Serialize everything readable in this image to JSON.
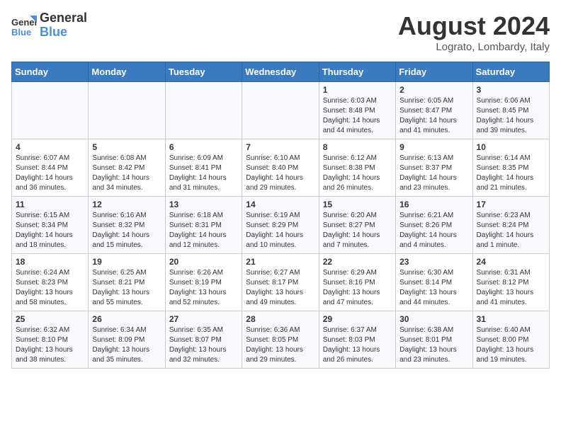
{
  "header": {
    "logo_line1": "General",
    "logo_line2": "Blue",
    "month_title": "August 2024",
    "subtitle": "Lograto, Lombardy, Italy"
  },
  "days_of_week": [
    "Sunday",
    "Monday",
    "Tuesday",
    "Wednesday",
    "Thursday",
    "Friday",
    "Saturday"
  ],
  "weeks": [
    [
      {
        "day": "",
        "info": ""
      },
      {
        "day": "",
        "info": ""
      },
      {
        "day": "",
        "info": ""
      },
      {
        "day": "",
        "info": ""
      },
      {
        "day": "1",
        "info": "Sunrise: 6:03 AM\nSunset: 8:48 PM\nDaylight: 14 hours and 44 minutes."
      },
      {
        "day": "2",
        "info": "Sunrise: 6:05 AM\nSunset: 8:47 PM\nDaylight: 14 hours and 41 minutes."
      },
      {
        "day": "3",
        "info": "Sunrise: 6:06 AM\nSunset: 8:45 PM\nDaylight: 14 hours and 39 minutes."
      }
    ],
    [
      {
        "day": "4",
        "info": "Sunrise: 6:07 AM\nSunset: 8:44 PM\nDaylight: 14 hours and 36 minutes."
      },
      {
        "day": "5",
        "info": "Sunrise: 6:08 AM\nSunset: 8:42 PM\nDaylight: 14 hours and 34 minutes."
      },
      {
        "day": "6",
        "info": "Sunrise: 6:09 AM\nSunset: 8:41 PM\nDaylight: 14 hours and 31 minutes."
      },
      {
        "day": "7",
        "info": "Sunrise: 6:10 AM\nSunset: 8:40 PM\nDaylight: 14 hours and 29 minutes."
      },
      {
        "day": "8",
        "info": "Sunrise: 6:12 AM\nSunset: 8:38 PM\nDaylight: 14 hours and 26 minutes."
      },
      {
        "day": "9",
        "info": "Sunrise: 6:13 AM\nSunset: 8:37 PM\nDaylight: 14 hours and 23 minutes."
      },
      {
        "day": "10",
        "info": "Sunrise: 6:14 AM\nSunset: 8:35 PM\nDaylight: 14 hours and 21 minutes."
      }
    ],
    [
      {
        "day": "11",
        "info": "Sunrise: 6:15 AM\nSunset: 8:34 PM\nDaylight: 14 hours and 18 minutes."
      },
      {
        "day": "12",
        "info": "Sunrise: 6:16 AM\nSunset: 8:32 PM\nDaylight: 14 hours and 15 minutes."
      },
      {
        "day": "13",
        "info": "Sunrise: 6:18 AM\nSunset: 8:31 PM\nDaylight: 14 hours and 12 minutes."
      },
      {
        "day": "14",
        "info": "Sunrise: 6:19 AM\nSunset: 8:29 PM\nDaylight: 14 hours and 10 minutes."
      },
      {
        "day": "15",
        "info": "Sunrise: 6:20 AM\nSunset: 8:27 PM\nDaylight: 14 hours and 7 minutes."
      },
      {
        "day": "16",
        "info": "Sunrise: 6:21 AM\nSunset: 8:26 PM\nDaylight: 14 hours and 4 minutes."
      },
      {
        "day": "17",
        "info": "Sunrise: 6:23 AM\nSunset: 8:24 PM\nDaylight: 14 hours and 1 minute."
      }
    ],
    [
      {
        "day": "18",
        "info": "Sunrise: 6:24 AM\nSunset: 8:23 PM\nDaylight: 13 hours and 58 minutes."
      },
      {
        "day": "19",
        "info": "Sunrise: 6:25 AM\nSunset: 8:21 PM\nDaylight: 13 hours and 55 minutes."
      },
      {
        "day": "20",
        "info": "Sunrise: 6:26 AM\nSunset: 8:19 PM\nDaylight: 13 hours and 52 minutes."
      },
      {
        "day": "21",
        "info": "Sunrise: 6:27 AM\nSunset: 8:17 PM\nDaylight: 13 hours and 49 minutes."
      },
      {
        "day": "22",
        "info": "Sunrise: 6:29 AM\nSunset: 8:16 PM\nDaylight: 13 hours and 47 minutes."
      },
      {
        "day": "23",
        "info": "Sunrise: 6:30 AM\nSunset: 8:14 PM\nDaylight: 13 hours and 44 minutes."
      },
      {
        "day": "24",
        "info": "Sunrise: 6:31 AM\nSunset: 8:12 PM\nDaylight: 13 hours and 41 minutes."
      }
    ],
    [
      {
        "day": "25",
        "info": "Sunrise: 6:32 AM\nSunset: 8:10 PM\nDaylight: 13 hours and 38 minutes."
      },
      {
        "day": "26",
        "info": "Sunrise: 6:34 AM\nSunset: 8:09 PM\nDaylight: 13 hours and 35 minutes."
      },
      {
        "day": "27",
        "info": "Sunrise: 6:35 AM\nSunset: 8:07 PM\nDaylight: 13 hours and 32 minutes."
      },
      {
        "day": "28",
        "info": "Sunrise: 6:36 AM\nSunset: 8:05 PM\nDaylight: 13 hours and 29 minutes."
      },
      {
        "day": "29",
        "info": "Sunrise: 6:37 AM\nSunset: 8:03 PM\nDaylight: 13 hours and 26 minutes."
      },
      {
        "day": "30",
        "info": "Sunrise: 6:38 AM\nSunset: 8:01 PM\nDaylight: 13 hours and 23 minutes."
      },
      {
        "day": "31",
        "info": "Sunrise: 6:40 AM\nSunset: 8:00 PM\nDaylight: 13 hours and 19 minutes."
      }
    ]
  ]
}
